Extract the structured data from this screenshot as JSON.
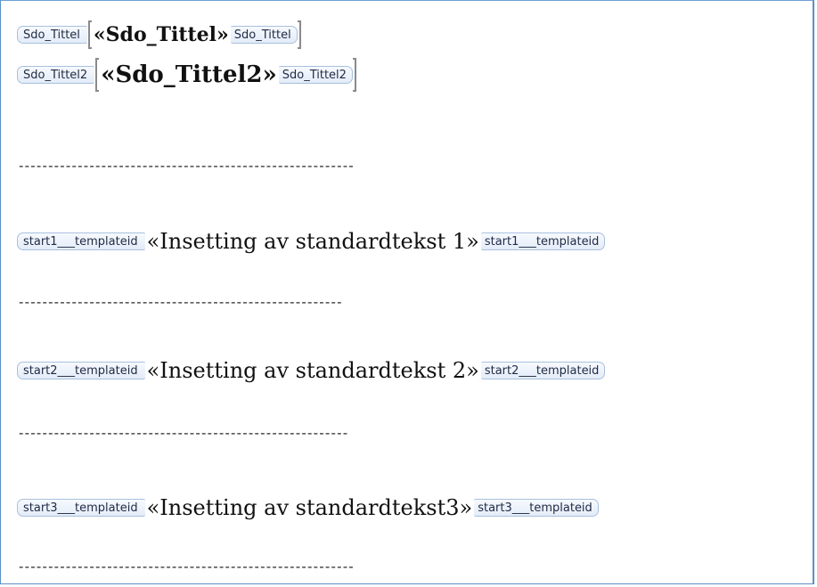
{
  "rows": [
    {
      "tag": "Sdo_Tittel",
      "field": "«Sdo_Tittel»"
    },
    {
      "tag": "Sdo_Tittel2",
      "field": "«Sdo_Tittel2»"
    },
    {
      "tag": "start1___templateid",
      "field": "«Insetting av standardtekst 1»"
    },
    {
      "tag": "start2___templateid",
      "field": "«Insetting av standardtekst 2»"
    },
    {
      "tag": "start3___templateid",
      "field": "«Insetting av standardtekst3»"
    }
  ],
  "separators": [
    "---------------------------------------------------------",
    "-------------------------------------------------------",
    "--------------------------------------------------------",
    "---------------------------------------------------------"
  ]
}
